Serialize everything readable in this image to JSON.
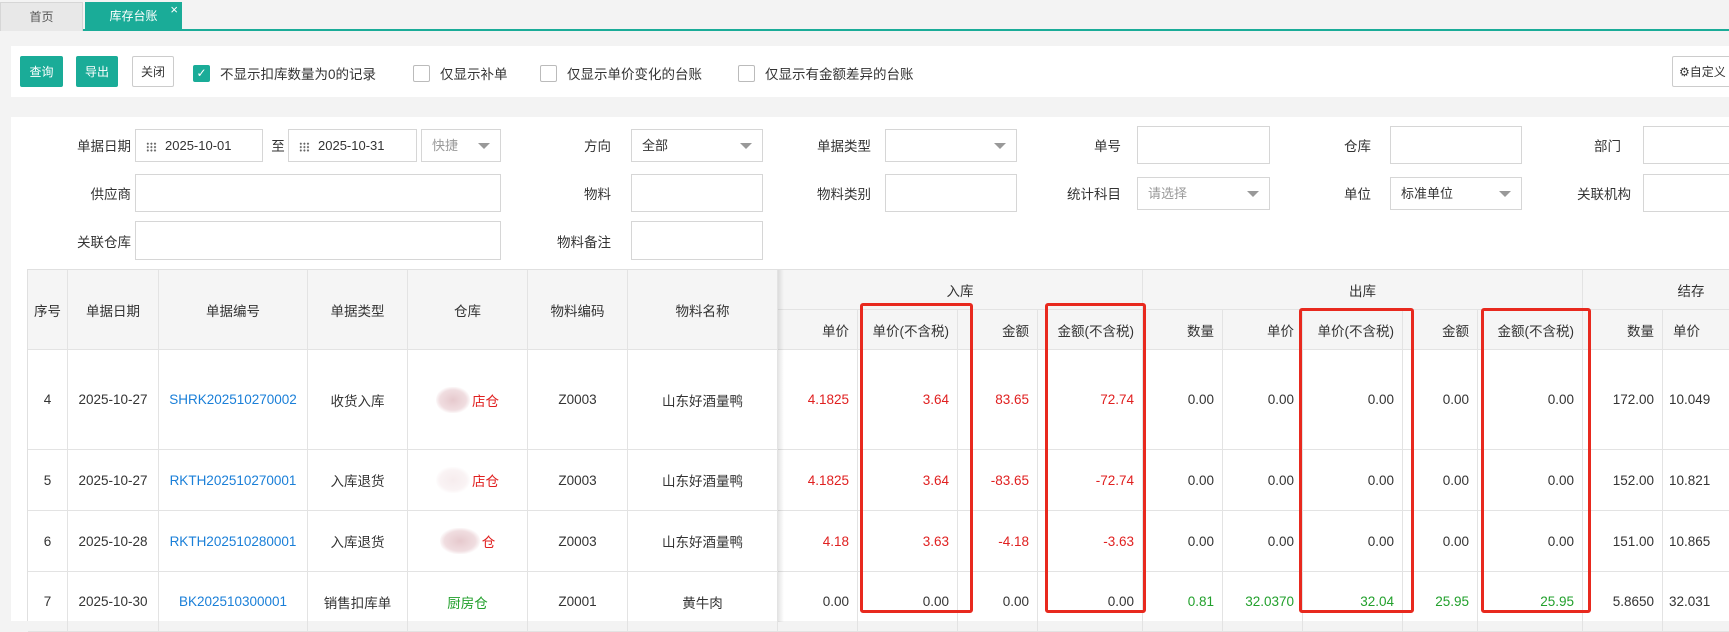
{
  "tabs": {
    "home": "首页",
    "active": "库存台账",
    "close": "×"
  },
  "toolbar": {
    "query": "查询",
    "export": "导出",
    "close": "关闭",
    "checks": [
      {
        "label": "不显示扣库数量为0的记录",
        "checked": true
      },
      {
        "label": "仅显示补单",
        "checked": false
      },
      {
        "label": "仅显示单价变化的台账",
        "checked": false
      },
      {
        "label": "仅显示有金额差异的台账",
        "checked": false
      }
    ],
    "custom": "⚙自定义"
  },
  "filters": {
    "date_label": "单据日期",
    "date_from": "2025-10-01",
    "to": "至",
    "date_to": "2025-10-31",
    "quick": "快捷",
    "direction_label": "方向",
    "direction": "全部",
    "doc_type_label": "单据类型",
    "doc_type": "",
    "doc_no_label": "单号",
    "doc_no": "",
    "warehouse_label": "仓库",
    "warehouse": "",
    "dept_label": "部门",
    "dept": "",
    "supplier_label": "供应商",
    "supplier": "",
    "material_label": "物料",
    "material": "",
    "material_cat_label": "物料类别",
    "material_cat": "",
    "stat_subject_label": "统计科目",
    "stat_subject": "请选择",
    "unit_label": "单位",
    "unit": "标准单位",
    "org_label": "关联机构",
    "org": "",
    "rel_wh_label": "关联仓库",
    "rel_wh": "",
    "material_note_label": "物料备注",
    "material_note": ""
  },
  "table": {
    "headers": {
      "seq": "序号",
      "date": "单据日期",
      "doc_no": "单据编号",
      "doc_type": "单据类型",
      "warehouse": "仓库",
      "mat_code": "物料编码",
      "mat_name": "物料名称",
      "in_group": "入库",
      "out_group": "出库",
      "bal_group": "结存",
      "in_price": "单价",
      "in_price_nt": "单价(不含税)",
      "in_amt": "金额",
      "in_amt_nt": "金额(不含税)",
      "out_qty": "数量",
      "out_price": "单价",
      "out_price_nt": "单价(不含税)",
      "out_amt": "金额",
      "out_amt_nt": "金额(不含税)",
      "bal_qty": "数量",
      "bal_price": "单价"
    },
    "rows": [
      {
        "seq": "4",
        "date": "2025-10-27",
        "doc_no": "SHRK202510270002",
        "doc_type": "收货入库",
        "warehouse": "店仓",
        "mat_code": "Z0003",
        "mat_name": "山东好酒量鸭",
        "in_price": "4.1825",
        "in_price_nt": "3.64",
        "in_amt": "83.65",
        "in_amt_nt": "72.74",
        "out_qty": "0.00",
        "out_price": "0.00",
        "out_price_nt": "0.00",
        "out_amt": "0.00",
        "out_amt_nt": "0.00",
        "bal_qty": "172.00",
        "bal_price": "10.049"
      },
      {
        "seq": "5",
        "date": "2025-10-27",
        "doc_no": "RKTH202510270001",
        "doc_type": "入库退货",
        "warehouse": "店仓",
        "mat_code": "Z0003",
        "mat_name": "山东好酒量鸭",
        "in_price": "4.1825",
        "in_price_nt": "3.64",
        "in_amt": "-83.65",
        "in_amt_nt": "-72.74",
        "out_qty": "0.00",
        "out_price": "0.00",
        "out_price_nt": "0.00",
        "out_amt": "0.00",
        "out_amt_nt": "0.00",
        "bal_qty": "152.00",
        "bal_price": "10.821"
      },
      {
        "seq": "6",
        "date": "2025-10-28",
        "doc_no": "RKTH202510280001",
        "doc_type": "入库退货",
        "warehouse": "仓",
        "mat_code": "Z0003",
        "mat_name": "山东好酒量鸭",
        "in_price": "4.18",
        "in_price_nt": "3.63",
        "in_amt": "-4.18",
        "in_amt_nt": "-3.63",
        "out_qty": "0.00",
        "out_price": "0.00",
        "out_price_nt": "0.00",
        "out_amt": "0.00",
        "out_amt_nt": "0.00",
        "bal_qty": "151.00",
        "bal_price": "10.865"
      },
      {
        "seq": "7",
        "date": "2025-10-30",
        "doc_no": "BK202510300001",
        "doc_type": "销售扣库单",
        "warehouse": "厨房仓",
        "mat_code": "Z0001",
        "mat_name": "黄牛肉",
        "in_price": "0.00",
        "in_price_nt": "0.00",
        "in_amt": "0.00",
        "in_amt_nt": "0.00",
        "out_qty": "0.81",
        "out_price": "32.0370",
        "out_price_nt": "32.04",
        "out_amt": "25.95",
        "out_amt_nt": "25.95",
        "bal_qty": "5.8650",
        "bal_price": "32.031"
      }
    ]
  },
  "colors": {
    "accent": "#1aac98",
    "negative": "#e02020",
    "positive": "#22a02c",
    "link": "#1a7fd8",
    "highlight": "#e8291e"
  }
}
